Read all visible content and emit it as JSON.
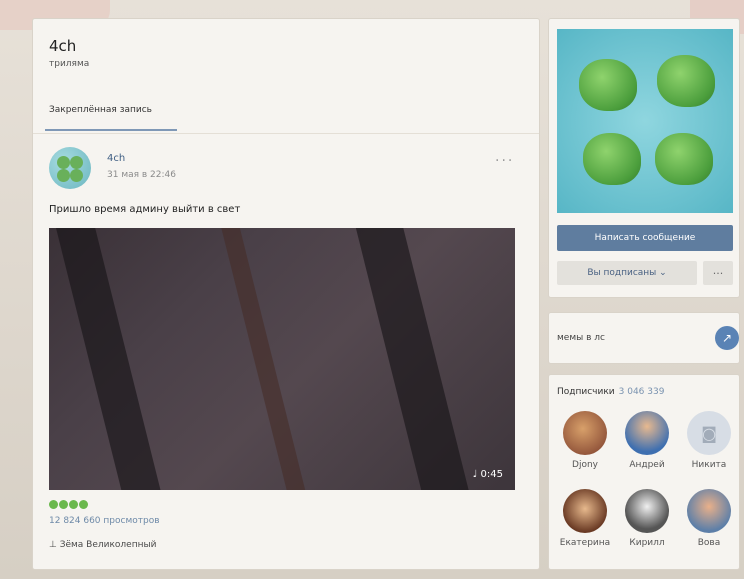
{
  "group": {
    "title": "4ch",
    "subtitle": "триляма",
    "pinned_tab": "Закреплённая запись"
  },
  "post": {
    "author": "4ch",
    "date": "31 мая в 22:46",
    "more": "···",
    "text": "Пришло время админу выйти в свет",
    "video_duration": "0:45",
    "views": "12 824 660 просмотров",
    "signer": "Зёма Великолепный"
  },
  "sidebar": {
    "write_message": "Написать сообщение",
    "subscribed": "Вы подписаны ⌄",
    "more": "···",
    "memes_link": "мемы в лс",
    "subscribers_label": "Подписчики",
    "subscribers_count": "3 046 339",
    "friends": [
      {
        "name": "Djony"
      },
      {
        "name": "Андрей"
      },
      {
        "name": "Никита"
      },
      {
        "name": "Екатерина"
      },
      {
        "name": "Кирилл"
      },
      {
        "name": "Вова"
      }
    ]
  },
  "colors": {
    "accent": "#5f7d9f",
    "link": "#3f5e83",
    "panel": "#f6f4f0"
  }
}
